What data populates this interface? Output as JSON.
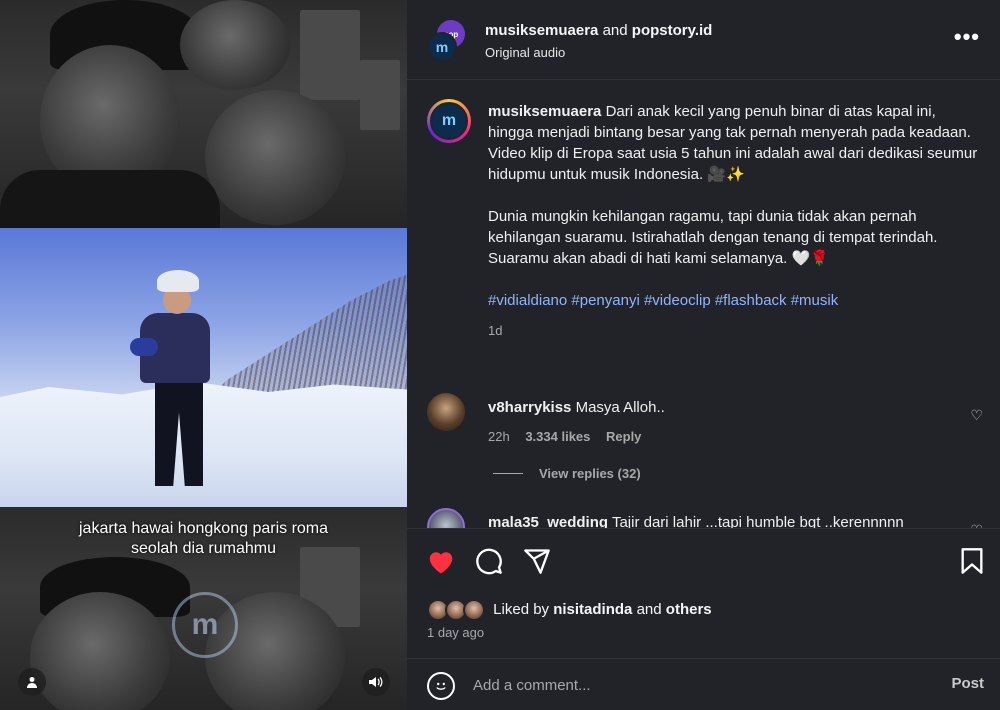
{
  "video": {
    "subtitle_line1": "jakarta hawai hongkong paris roma",
    "subtitle_line2": "seolah dia rumahmu",
    "watermark_glyph": "m",
    "user_icon": "person-icon",
    "sound_icon": "speaker-icon"
  },
  "header": {
    "author": "musiksemuaera",
    "and": "and",
    "collaborator": "popstory.id",
    "audio": "Original audio",
    "more": "•••",
    "collab_avatar_text": "pop"
  },
  "caption": {
    "author": "musiksemuaera",
    "paragraph1": "Dari anak kecil yang penuh binar di atas kapal ini, hingga menjadi bintang besar yang tak pernah menyerah pada keadaan. Video klip di Eropa saat usia 5 tahun ini adalah awal dari dedikasi seumur hidupmu untuk musik Indonesia. 🎥✨",
    "paragraph2": "Dunia mungkin kehilangan ragamu, tapi dunia tidak akan pernah kehilangan suaramu. Istirahatlah dengan tenang di tempat terindah. Suaramu akan abadi di hati kami selamanya. 🤍🌹",
    "hashtags": "#vidialdiano #penyanyi #videoclip #flashback #musik",
    "time": "1d"
  },
  "comments": [
    {
      "user": "v8harrykiss",
      "text": "Masya Alloh..",
      "time": "22h",
      "likes": "3.334 likes",
      "reply": "Reply",
      "view_replies": "View replies (32)"
    },
    {
      "user": "mala35_wedding",
      "text": "Tajir dari lahir ...tapi humble bgt ..kerennnnn"
    }
  ],
  "actions": {
    "liked_prefix": "Liked by",
    "liked_user": "nisitadinda",
    "liked_and": "and",
    "liked_others": "others",
    "posted": "1 day ago"
  },
  "add_comment": {
    "placeholder": "Add a comment...",
    "post": "Post"
  },
  "colors": {
    "panel_bg": "#212328",
    "like_red": "#ff3040",
    "hashtag_blue": "#8fb4ff"
  }
}
